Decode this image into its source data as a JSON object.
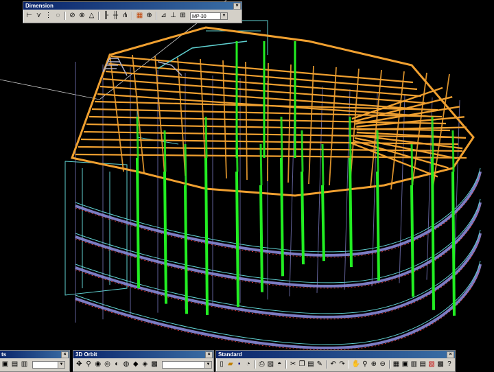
{
  "toolbars": {
    "dimension": {
      "title": "Dimension",
      "close_glyph": "×",
      "dimstyle_value": "MP-30",
      "icons": [
        "linear-dim-icon",
        "aligned-dim-icon",
        "ordinate-dim-icon",
        "radius-dim-icon",
        "diameter-dim-icon",
        "angular-dim-icon",
        "quick-dim-icon",
        "baseline-dim-icon",
        "continue-dim-icon",
        "leader-icon",
        "tolerance-icon",
        "center-mark-icon",
        "dimedit-icon",
        "dimtedit-icon",
        "dimstyle-icon"
      ]
    },
    "layouts": {
      "title": "ts",
      "close_glyph": "×"
    },
    "orbit3d": {
      "title": "3D Orbit",
      "close_glyph": "×"
    },
    "standard": {
      "title": "Standard",
      "close_glyph": "×"
    }
  },
  "colors": {
    "columns": "#22ee22",
    "beams_top": "#f0a030",
    "frame": "#8a8ad8",
    "slab_edge": "#5fd0d0",
    "accent": "#ff4040"
  }
}
